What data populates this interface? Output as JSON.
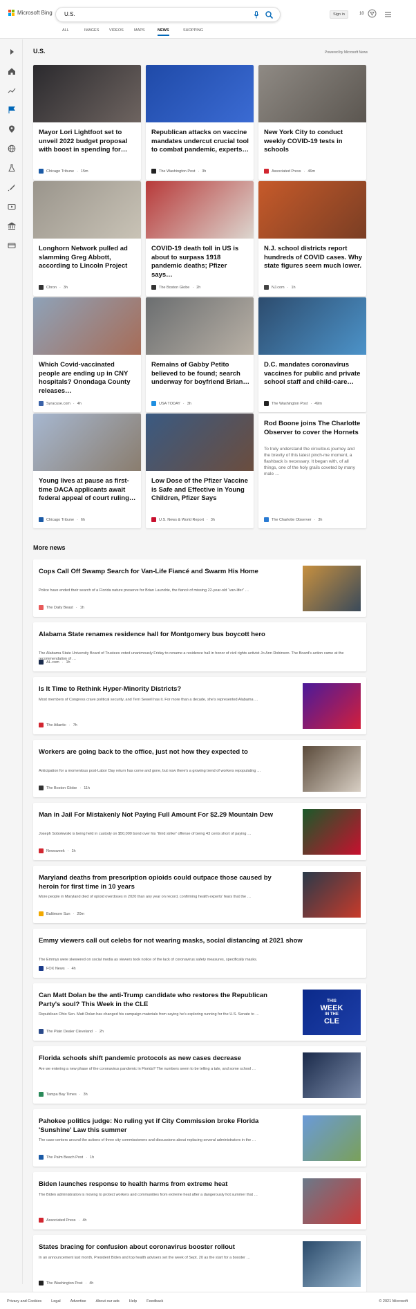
{
  "header": {
    "logo_text": "Microsoft Bing",
    "search_query": "U.S.",
    "sign_in": "Sign in",
    "rewards_count": "10"
  },
  "tabs": [
    {
      "label": "ALL"
    },
    {
      "label": "IMAGES"
    },
    {
      "label": "VIDEOS"
    },
    {
      "label": "MAPS"
    },
    {
      "label": "NEWS"
    },
    {
      "label": "SHOPPING"
    }
  ],
  "active_tab": "NEWS",
  "colors": {
    "accent": "#0067b8",
    "brand_blue": "#00a4ef",
    "brand_red": "#f25022",
    "brand_green": "#7fba00",
    "brand_yellow": "#ffb900"
  },
  "section": {
    "title": "U.S.",
    "powered_by": "Powered by Microsoft News"
  },
  "cards": [
    {
      "title": "Mayor Lori Lightfoot set to unveil 2022 budget proposal with boost in spending for…",
      "source": "Chicago Tribune",
      "time": "15m",
      "logo_color": "#1b5aa6",
      "img_a": "#2b2a2e",
      "img_b": "#6e6460"
    },
    {
      "title": "Republican attacks on vaccine mandates undercut crucial tool to combat pandemic, experts…",
      "source": "The Washington Post",
      "time": "3h",
      "logo_color": "#222222",
      "img_a": "#1f4aa8",
      "img_b": "#3b6bd3"
    },
    {
      "title": "New York City to conduct weekly COVID-19 tests in schools",
      "source": "Associated Press",
      "time": "46m",
      "logo_color": "#d22630",
      "img_a": "#8f8a84",
      "img_b": "#5b5650"
    },
    {
      "title": "Longhorn Network pulled ad slamming Greg Abbott, according to Lincoln Project",
      "source": "Chron",
      "time": "3h",
      "logo_color": "#333333",
      "img_a": "#9a958c",
      "img_b": "#c9c3b6"
    },
    {
      "title": "COVID-19 death toll in US is about to surpass 1918 pandemic deaths; Pfizer says…",
      "source": "The Boston Globe",
      "time": "2h",
      "logo_color": "#333333",
      "img_a": "#b83a3a",
      "img_b": "#dcd6cf"
    },
    {
      "title": "N.J. school districts report hundreds of COVID cases. Why state figures seem much lower.",
      "source": "NJ.com",
      "time": "1h",
      "logo_color": "#444444",
      "img_a": "#c65a2a",
      "img_b": "#7a3e24"
    },
    {
      "title": "Which Covid-vaccinated people are ending up in CNY hospitals? Onondaga County releases…",
      "source": "Syracuse.com",
      "time": "4h",
      "logo_color": "#3a62a8",
      "img_a": "#8ea2b8",
      "img_b": "#a76c57"
    },
    {
      "title": "Remains of Gabby Petito believed to be found; search underway for boyfriend Brian…",
      "source": "USA TODAY",
      "time": "3h",
      "logo_color": "#1e8fe1",
      "img_a": "#6b6e70",
      "img_b": "#b9b1a6"
    },
    {
      "title": "D.C. mandates coronavirus vaccines for public and private school staff and child-care…",
      "source": "The Washington Post",
      "time": "49m",
      "logo_color": "#222222",
      "img_a": "#2d4c6e",
      "img_b": "#4c93c9"
    },
    {
      "title": "Young lives at pause as first-time DACA applicants await federal appeal of court ruling…",
      "source": "Chicago Tribune",
      "time": "6h",
      "logo_color": "#1b5aa6",
      "img_a": "#a6b7d0",
      "img_b": "#8a7d6e"
    },
    {
      "title": "Low Dose of the Pfizer Vaccine is Safe and Effective in Young Children, Pfizer Says",
      "source": "U.S. News & World Report",
      "time": "3h",
      "logo_color": "#c8102e",
      "img_a": "#3a5a82",
      "img_b": "#6b4d3e"
    },
    {
      "title": "Rod Boone joins The Charlotte Observer to cover the Hornets",
      "desc": "To truly understand the circuitous journey and the brevity of this latest pinch-me moment, a flashback is necessary. It began with, of all things, one of the holy grails coveted by many male …",
      "source": "The Charlotte Observer",
      "time": "3h",
      "logo_color": "#2a7bd3"
    }
  ],
  "more_news": {
    "title": "More news",
    "items": [
      {
        "title": "Cops Call Off Swamp Search for Van-Life Fiancé and Swarm His Home",
        "desc": "Police have ended their search of a Florida nature preserve for Brian Laundrie, the fiancé of missing 22-year-old “van-lifer” …",
        "source": "The Daily Beast",
        "time": "1h",
        "logo_color": "#e85a5a",
        "img_a": "#c7903f",
        "img_b": "#3a4a5a"
      },
      {
        "title": "Alabama State renames residence hall for Montgomery bus boycott hero",
        "desc": "The Alabama State University Board of Trustees voted unanimously Friday to rename a residence hall in honor of civil rights activist Jo Ann Robinson. The Board's action came at the recommendation of …",
        "source": "AL.com",
        "time": "1h",
        "logo_color": "#1a2b4c"
      },
      {
        "title": "Is It Time to Rethink Hyper-Minority Districts?",
        "desc": "Most members of Congress crave political security, and Terri Sewell has it. For more than a decade, she's represented Alabama …",
        "source": "The Atlantic",
        "time": "7h",
        "logo_color": "#d22630",
        "img_a": "#4a1a9a",
        "img_b": "#d21f3c"
      },
      {
        "title": "Workers are going back to the office, just not how they expected to",
        "desc": "Anticipation for a momentous post-Labor Day return has come and gone, but now there's a growing trend of workers repopulating …",
        "source": "The Boston Globe",
        "time": "11h",
        "logo_color": "#333333",
        "img_a": "#5a4a3a",
        "img_b": "#d8cfc4"
      },
      {
        "title": "Man in Jail For Mistakenly Not Paying Full Amount For $2.29 Mountain Dew",
        "desc": "Joseph Sobolewski is being held in custody on $50,000 bond over his “third strike” offense of being 43 cents short of paying …",
        "source": "Newsweek",
        "time": "1h",
        "logo_color": "#d22630",
        "img_a": "#1a5a2a",
        "img_b": "#c8102e"
      },
      {
        "title": "Maryland deaths from prescription opioids could outpace those caused by heroin for first time in 10 years",
        "desc": "More people in Maryland died of opioid overdoses in 2020 than any year on record, confirming health experts' fears that the …",
        "source": "Baltimore Sun",
        "time": "20m",
        "logo_color": "#f2a900",
        "img_a": "#2a3a4a",
        "img_b": "#c83a2a"
      },
      {
        "title": "Emmy viewers call out celebs for not wearing masks, social distancing at 2021 show",
        "desc": "The Emmys were skewered on social media as viewers took notice of the lack of coronavirus safety measures, specifically masks.",
        "source": "FOX News",
        "time": "4h",
        "logo_color": "#1a3a8a"
      },
      {
        "title": "Can Matt Dolan be the anti-Trump candidate who restores the Republican Party's soul? This Week in the CLE",
        "desc": "Republican Ohio Sen. Matt Dolan has changed his campaign materials from saying he's exploring running for the U.S. Senate to …",
        "source": "The Plain Dealer Cleveland",
        "time": "2h",
        "logo_color": "#2a4a8a",
        "img_a": "#0b2a8a",
        "img_b": "#1d3ea8",
        "img_text_1": "THIS",
        "img_text_2": "WEEK",
        "img_text_3": "IN THE",
        "img_text_4": "CLE"
      },
      {
        "title": "Florida schools shift pandemic protocols as new cases decrease",
        "desc": "Are we entering a new phase of the coronavirus pandemic in Florida? The numbers seem to be telling a tale, and some school …",
        "source": "Tampa Bay Times",
        "time": "3h",
        "logo_color": "#2a8a5a",
        "img_a": "#1a2a4a",
        "img_b": "#7a8aa8"
      },
      {
        "title": "Pahokee politics judge: No ruling yet if City Commission broke Florida 'Sunshine' Law this summer",
        "desc": "The case centers around the actions of three city commissioners and discussions about replacing several administrators in the …",
        "source": "The Palm Beach Post",
        "time": "1h",
        "logo_color": "#1a5aa6",
        "img_a": "#6a9ad8",
        "img_b": "#7aa05a"
      },
      {
        "title": "Biden launches response to health harms from extreme heat",
        "desc": "The Biden administration is moving to protect workers and communities from extreme heat after a dangerously hot summer that …",
        "source": "Associated Press",
        "time": "4h",
        "logo_color": "#d22630",
        "img_a": "#6a7a8a",
        "img_b": "#c83a3a"
      },
      {
        "title": "States bracing for confusion about coronavirus booster rollout",
        "desc": "In an announcement last month, President Biden and top health advisers set the week of Sept. 20 as the start for a booster …",
        "source": "The Washington Post",
        "time": "4h",
        "logo_color": "#222222",
        "img_a": "#2a4a6a",
        "img_b": "#9ab8d0"
      }
    ]
  },
  "footer": {
    "links": [
      "Privacy and Cookies",
      "Legal",
      "Advertise",
      "About our ads",
      "Help",
      "Feedback"
    ],
    "copyright": "© 2021 Microsoft"
  }
}
